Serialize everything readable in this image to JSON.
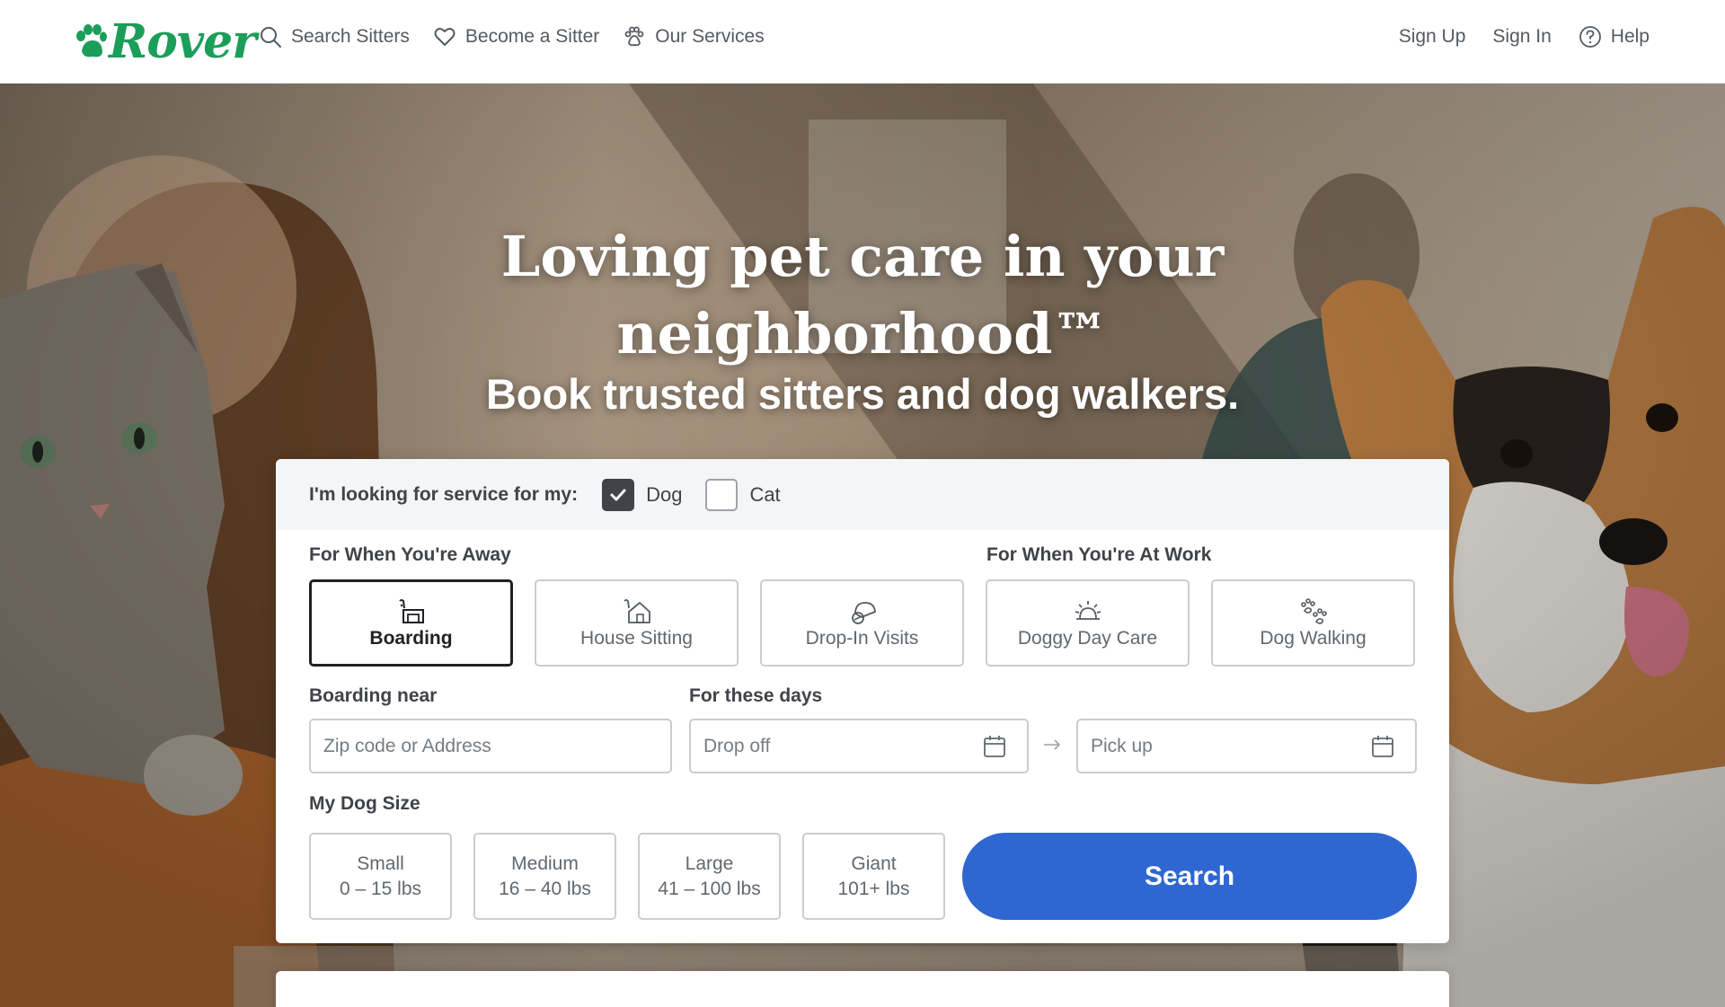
{
  "header": {
    "logo_text": "Rover",
    "nav": [
      {
        "label": "Search Sitters",
        "icon": "search-icon"
      },
      {
        "label": "Become a Sitter",
        "icon": "heart-icon"
      },
      {
        "label": "Our Services",
        "icon": "paw-icon"
      }
    ],
    "right": {
      "sign_up": "Sign Up",
      "sign_in": "Sign In",
      "help": "Help"
    }
  },
  "hero": {
    "title_line1": "Loving pet care in your",
    "title_line2": "neighborhood™",
    "subtitle": "Book trusted sitters and dog walkers."
  },
  "search": {
    "pet_prompt": "I'm looking for service for my:",
    "pets": [
      {
        "label": "Dog",
        "checked": true
      },
      {
        "label": "Cat",
        "checked": false
      }
    ],
    "away_label": "For When You're Away",
    "work_label": "For When You're At Work",
    "services": [
      {
        "label": "Boarding",
        "icon": "boarding-icon",
        "selected": true
      },
      {
        "label": "House Sitting",
        "icon": "house-icon",
        "selected": false
      },
      {
        "label": "Drop-In Visits",
        "icon": "drop-in-icon",
        "selected": false
      },
      {
        "label": "Doggy Day Care",
        "icon": "sun-icon",
        "selected": false
      },
      {
        "label": "Dog Walking",
        "icon": "paws-icon",
        "selected": false
      }
    ],
    "location_label": "Boarding near",
    "location_placeholder": "Zip code or Address",
    "dates_label": "For these days",
    "dropoff_placeholder": "Drop off",
    "pickup_placeholder": "Pick up",
    "size_label": "My Dog Size",
    "sizes": [
      {
        "name": "Small",
        "range": "0 – 15 lbs"
      },
      {
        "name": "Medium",
        "range": "16 – 40 lbs"
      },
      {
        "name": "Large",
        "range": "41 – 100 lbs"
      },
      {
        "name": "Giant",
        "range": "101+ lbs"
      }
    ],
    "search_button": "Search"
  },
  "colors": {
    "brand_green": "#1b9e59",
    "search_blue": "#2e67d1",
    "text_dark": "#404347"
  }
}
